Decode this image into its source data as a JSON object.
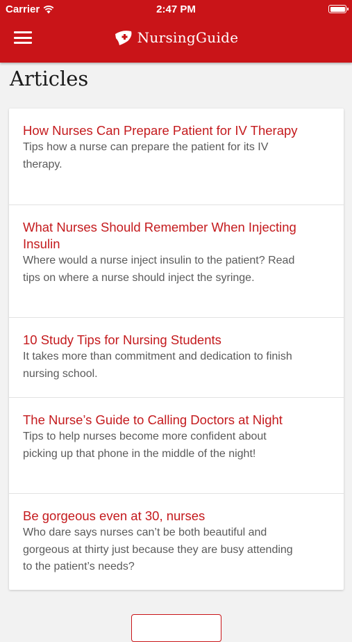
{
  "status_bar": {
    "carrier": "Carrier",
    "time": "2:47 PM"
  },
  "header": {
    "app_name": "NursingGuide",
    "brand_icon": "nurse-cap-icon",
    "menu_icon": "hamburger-menu-icon",
    "background_color": "#c91418"
  },
  "page": {
    "title": "Articles"
  },
  "articles": [
    {
      "title": "How Nurses Can Prepare Patient for IV Therapy",
      "description": "Tips how a nurse can prepare the patient for its IV therapy."
    },
    {
      "title": "What Nurses Should Remember When Injecting Insulin",
      "description": "Where would a nurse inject insulin to the patient? Read tips on where a nurse should inject the syringe."
    },
    {
      "title": "10 Study Tips for Nursing Students",
      "description": "It takes more than commitment and dedication to finish nursing school."
    },
    {
      "title": "The Nurse’s Guide to Calling Doctors at Night",
      "description": "Tips to help nurses become more confident about picking up that phone in the middle of the night!"
    },
    {
      "title": "Be gorgeous even at 30, nurses",
      "description": "Who dare says nurses can’t be both beautiful and gorgeous at thirty just because they are busy attending to the patient’s needs?"
    }
  ],
  "colors": {
    "accent": "#c91418",
    "article_title": "#c41a1d",
    "description_text": "#5a5a5a",
    "page_background": "#f2f2f2"
  }
}
